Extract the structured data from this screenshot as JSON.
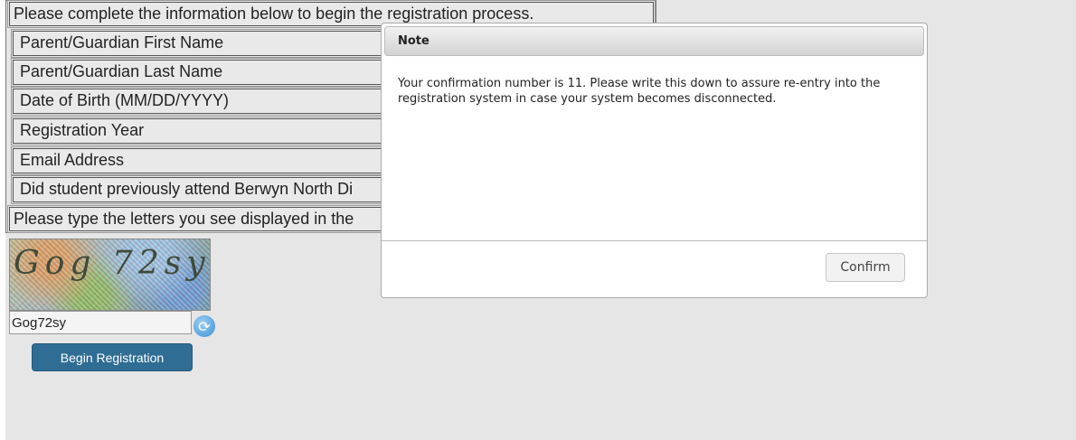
{
  "form": {
    "intro": "Please complete the information below to begin the registration process.",
    "fields": [
      "Parent/Guardian First Name",
      "Parent/Guardian Last Name",
      "Date of Birth (MM/DD/YYYY)",
      "Registration Year",
      "Email Address",
      "Did student previously attend Berwyn North Di"
    ],
    "captcha_prompt": "Please type the letters you see displayed in the"
  },
  "captcha": {
    "image_text": "Gog 72sy",
    "input_value": "Gog72sy",
    "refresh_icon": "refresh-icon"
  },
  "begin_button": "Begin Registration",
  "dialog": {
    "title": "Note",
    "message": "Your confirmation number is 11. Please write this down to assure re-entry into the registration system in case your system becomes disconnected.",
    "confirm_label": "Confirm"
  },
  "colors": {
    "page_bg": "#e6e6e6",
    "primary_button": "#2f6d94",
    "refresh_icon": "#3a8fd0"
  }
}
